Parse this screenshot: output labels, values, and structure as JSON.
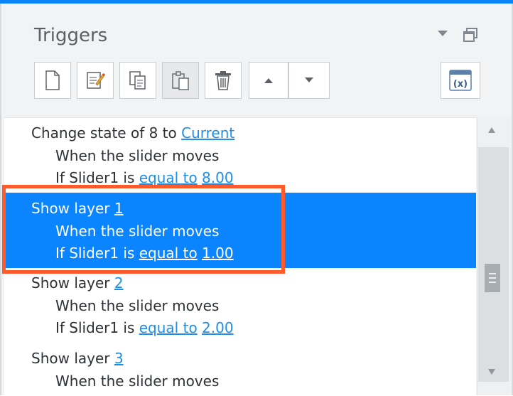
{
  "colors": {
    "accent": "#0a84ff",
    "link": "#1f8ee6",
    "highlight": "#ff5a2b"
  },
  "panel": {
    "title": "Triggers",
    "header_icons": [
      "dropdown-icon",
      "undock-window-icon"
    ]
  },
  "toolbar": {
    "buttons": [
      {
        "name": "new-trigger-button",
        "icon": "new-document-icon"
      },
      {
        "name": "edit-trigger-button",
        "icon": "edit-pencil-icon"
      },
      {
        "name": "copy-trigger-button",
        "icon": "copy-icon"
      },
      {
        "name": "paste-trigger-button",
        "icon": "paste-icon"
      },
      {
        "name": "delete-trigger-button",
        "icon": "trash-icon"
      },
      {
        "name": "move-up-button",
        "icon": "triangle-up-icon"
      },
      {
        "name": "move-down-button",
        "icon": "triangle-down-icon"
      },
      {
        "name": "variables-button",
        "icon": "variables-icon",
        "label": "(x)"
      }
    ]
  },
  "triggers": [
    {
      "action_text": "Change state of 8 to ",
      "action_link": "Current",
      "when": "When the slider moves",
      "if_prefix": "If Slider1  is ",
      "condition": "equal to",
      "value": "8.00"
    },
    {
      "action_text": "Show layer ",
      "action_link": "1",
      "when": "When the slider moves",
      "if_prefix": "If Slider1  is ",
      "condition": "equal to",
      "value": "1.00",
      "selected": true
    },
    {
      "action_text": "Show layer ",
      "action_link": "2",
      "when": "When the slider moves",
      "if_prefix": "If Slider1  is ",
      "condition": "equal to",
      "value": "2.00"
    },
    {
      "action_text": "Show layer ",
      "action_link": "3",
      "when": "When the slider moves"
    }
  ]
}
